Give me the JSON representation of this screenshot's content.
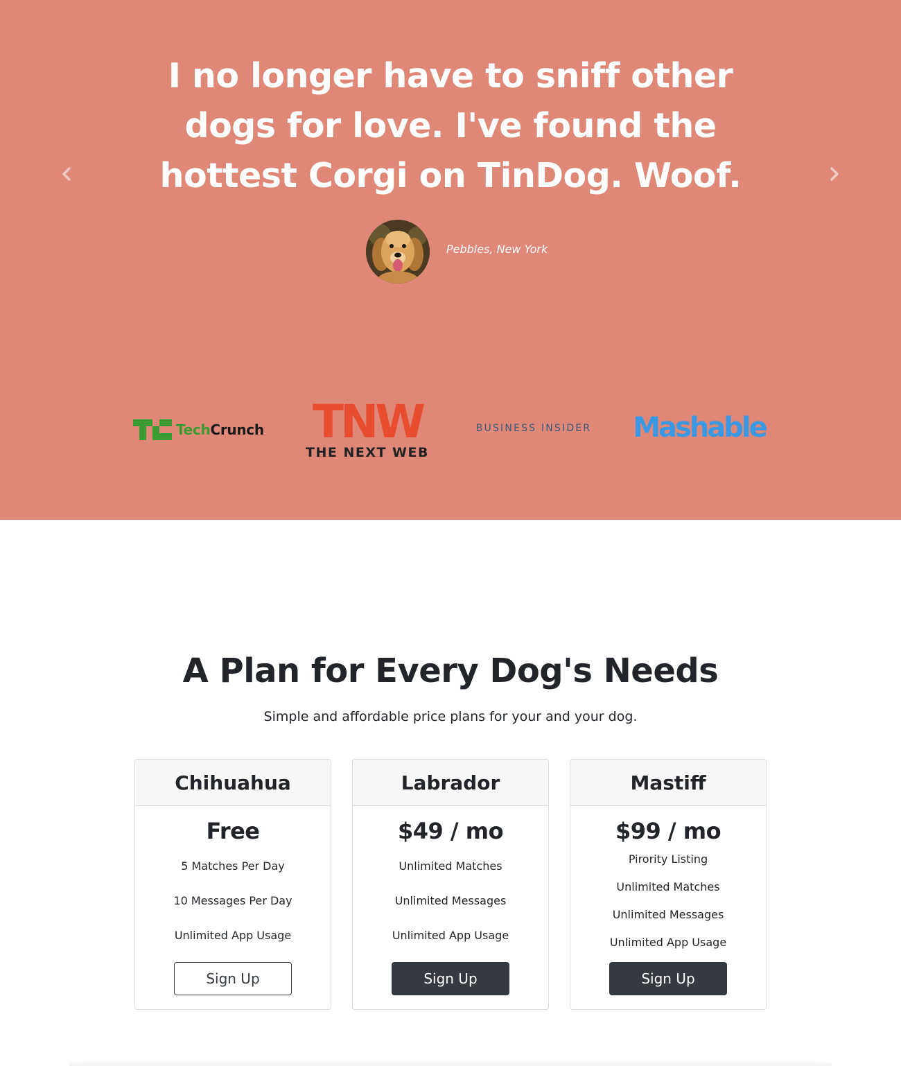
{
  "testimonial": {
    "quote": "I no longer have to sniff other dogs for love. I've found the hottest Corgi on TinDog. Woof.",
    "author": "Pebbles, New York",
    "prev_icon": "chevron-left-icon",
    "next_icon": "chevron-right-icon"
  },
  "press": {
    "techcrunch": {
      "tech": "Tech",
      "crunch": "Crunch"
    },
    "tnw": {
      "mark": "TNW",
      "name": "THE NEXT WEB"
    },
    "business_insider": "BUSINESS INSIDER",
    "mashable": "Mashable"
  },
  "pricing": {
    "title": "A Plan for Every Dog's Needs",
    "subtitle": "Simple and affordable price plans for your and your dog.",
    "plans": [
      {
        "name": "Chihuahua",
        "price": "Free",
        "features": [
          "5 Matches Per Day",
          "10 Messages Per Day",
          "Unlimited App Usage"
        ],
        "button": "Sign Up"
      },
      {
        "name": "Labrador",
        "price": "$49 / mo",
        "features": [
          "Unlimited Matches",
          "Unlimited Messages",
          "Unlimited App Usage"
        ],
        "button": "Sign Up"
      },
      {
        "name": "Mastiff",
        "price": "$99 / mo",
        "features": [
          "Pirority Listing",
          "Unlimited Matches",
          "Unlimited Messages",
          "Unlimited App Usage"
        ],
        "button": "Sign Up"
      }
    ]
  },
  "colors": {
    "hero_background": "#e08878",
    "button_dark": "#343a40",
    "techcrunch_green": "#3b9b33",
    "tnw_orange": "#e84d2f",
    "mashable_blue": "#3b99e3"
  }
}
